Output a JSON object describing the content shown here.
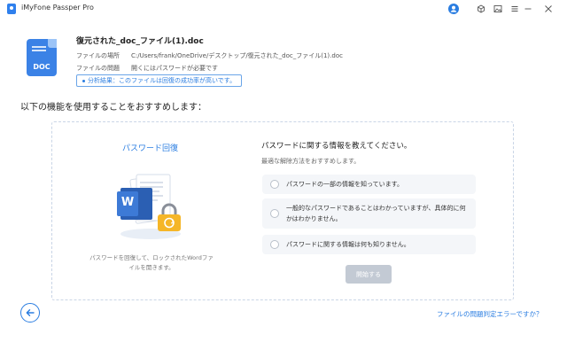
{
  "window": {
    "title": "iMyFone Passper Pro"
  },
  "file": {
    "name": "復元された_doc_ファイル(1).doc",
    "icon_label": "DOC",
    "location_label": "ファイルの場所",
    "location_value": "C:/Users/frank/OneDrive/デスクトップ/復元された_doc_ファイル(1).doc",
    "problem_label": "ファイルの問題",
    "problem_value": "開くにはパスワードが必要です",
    "analysis": "分析結果：このファイルは回復の成功率が高いです。"
  },
  "recommend_title": "以下の機能を使用することをおすすめします：",
  "feature": {
    "title": "パスワード回復",
    "description": "パスワードを回復して、ロックされたWordファイルを開きます。",
    "word_letter": "W"
  },
  "question": {
    "title": "パスワードに関する情報を教えてください。",
    "subtitle": "最適な解除方法をおすすめします。",
    "options": [
      {
        "label": "パスワードの一部の情報を知っています。",
        "selected": false
      },
      {
        "label": "一般的なパスワードであることはわかっていますが、具体的に何かはわかりません。",
        "selected": false
      },
      {
        "label": "パスワードに関する情報は何も知りません。",
        "selected": false
      }
    ],
    "start_button": "開始する",
    "start_enabled": false
  },
  "footer": {
    "help_link": "ファイルの問題判定エラーですか？"
  },
  "colors": {
    "accent": "#2a7de1",
    "disabled_button": "#c3cad4",
    "option_bg": "#f4f6f9"
  },
  "icons": [
    "app-logo",
    "user-icon",
    "cube-icon",
    "image-icon",
    "menu-icon",
    "minimize-icon",
    "close-icon",
    "arrow-left-icon",
    "lock-icon",
    "word-icon"
  ]
}
